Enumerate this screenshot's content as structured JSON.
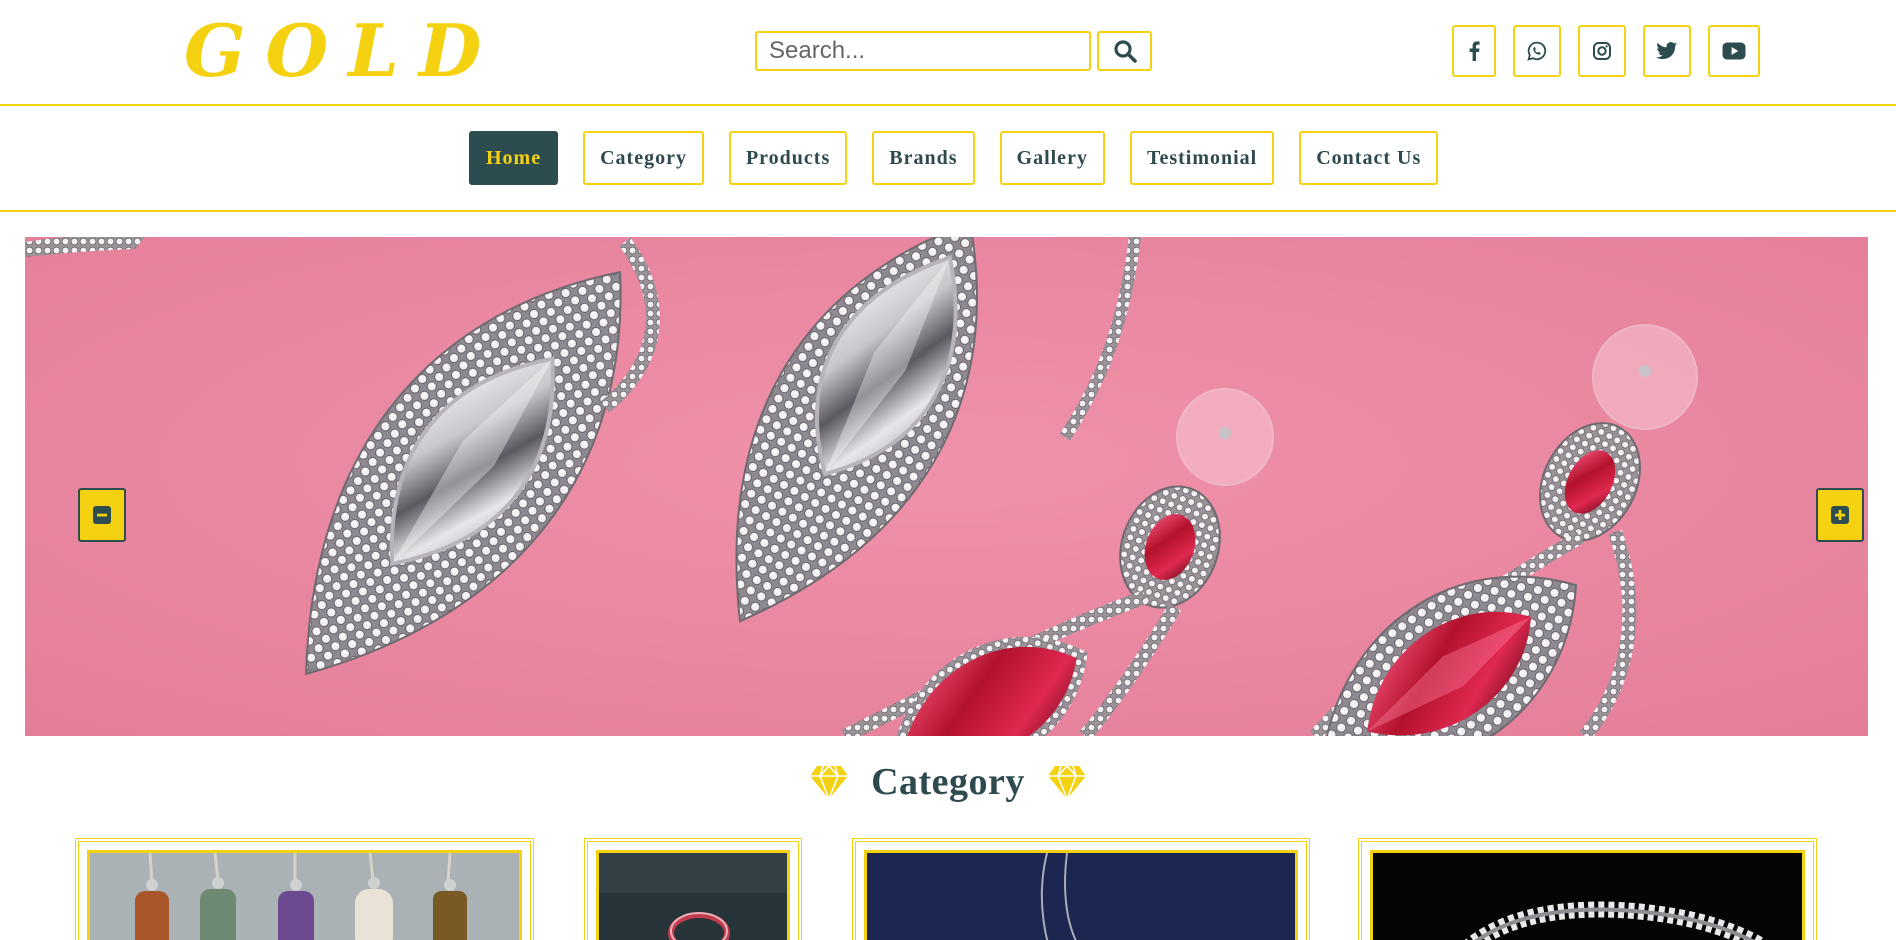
{
  "brand": {
    "logo_text": "GOLD",
    "accent_color": "#f5d211",
    "dark_color": "#2d4c4f"
  },
  "search": {
    "placeholder": "Search...",
    "button_icon": "search-icon"
  },
  "socials": [
    {
      "name": "facebook-icon"
    },
    {
      "name": "whatsapp-icon"
    },
    {
      "name": "instagram-icon"
    },
    {
      "name": "twitter-icon"
    },
    {
      "name": "youtube-icon"
    }
  ],
  "nav": {
    "items": [
      {
        "label": "Home",
        "active": true
      },
      {
        "label": "Category",
        "active": false
      },
      {
        "label": "Products",
        "active": false
      },
      {
        "label": "Brands",
        "active": false
      },
      {
        "label": "Gallery",
        "active": false
      },
      {
        "label": "Testimonial",
        "active": false
      },
      {
        "label": "Contact Us",
        "active": false
      }
    ]
  },
  "hero": {
    "prev_icon": "minus-square-icon",
    "next_icon": "plus-square-icon",
    "background_color": "#ec8aa2"
  },
  "category": {
    "title": "Category",
    "heading_icon": "diamond-icon",
    "cards": [
      {
        "name": "category-card-pendants"
      },
      {
        "name": "category-card-rings"
      },
      {
        "name": "category-card-necklaces"
      },
      {
        "name": "category-card-bracelets"
      }
    ]
  }
}
